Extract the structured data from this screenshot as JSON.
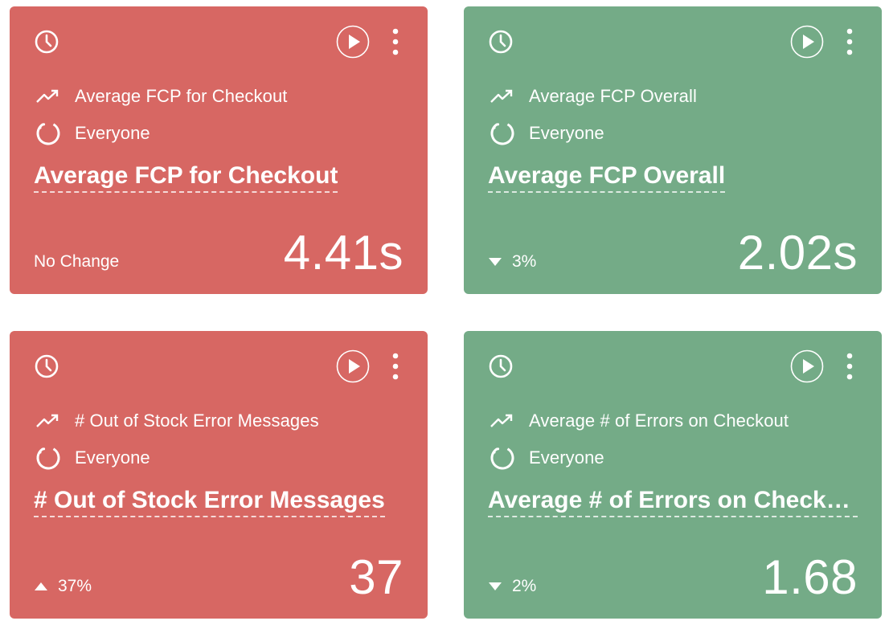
{
  "cards": [
    {
      "metric_name": "Average FCP for Checkout",
      "segment": "Everyone",
      "title": "Average FCP for Checkout",
      "change": "No Change",
      "change_direction": "none",
      "value": "4.41s",
      "status_color": "#d76763"
    },
    {
      "metric_name": "Average FCP Overall",
      "segment": "Everyone",
      "title": "Average FCP Overall",
      "change": "3%",
      "change_direction": "down",
      "value": "2.02s",
      "status_color": "#74ab87"
    },
    {
      "metric_name": "# Out of Stock Error Messages",
      "segment": "Everyone",
      "title": "# Out of Stock Error Messages",
      "change": "37%",
      "change_direction": "up",
      "value": "37",
      "status_color": "#d76763"
    },
    {
      "metric_name": "Average # of Errors on Checkout",
      "segment": "Everyone",
      "title": "Average # of Errors on Checkout",
      "change": "2%",
      "change_direction": "down",
      "value": "1.68",
      "status_color": "#74ab87"
    }
  ],
  "icons": {
    "schedule": "clock-icon",
    "play": "play-icon",
    "more": "more-vertical-icon",
    "metric": "trend-line-icon",
    "segment": "segment-circle-icon",
    "change_up": "triangle-up-icon",
    "change_down": "triangle-down-icon"
  }
}
